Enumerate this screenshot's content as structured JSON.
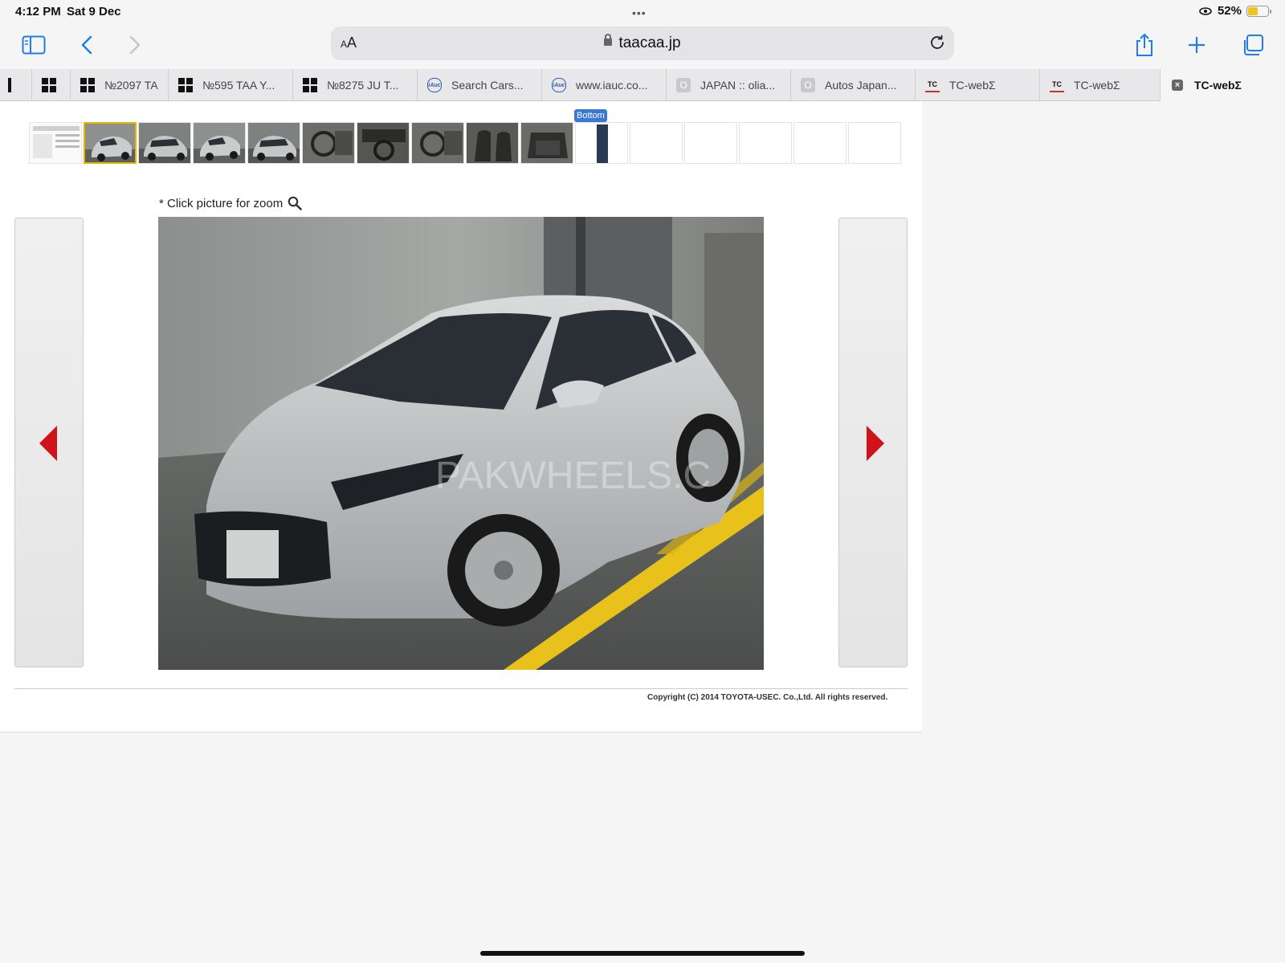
{
  "status_bar": {
    "time": "4:12 PM",
    "date": "Sat 9 Dec",
    "battery": "52%",
    "battery_level": 0.52
  },
  "toolbar": {
    "text_size_label": "AA",
    "url_host": "taacaa.jp",
    "icons": [
      "sidebar-icon",
      "back-icon",
      "forward-icon",
      "reload-icon",
      "share-icon",
      "plus-icon",
      "tabs-icon"
    ]
  },
  "tabs": [
    {
      "label": "",
      "favicon": "windows"
    },
    {
      "label": "№2097 TA",
      "favicon": "windows"
    },
    {
      "label": "№595 TAA Y...",
      "favicon": "windows"
    },
    {
      "label": "№8275 JU T...",
      "favicon": "windows"
    },
    {
      "label": "Search Cars...",
      "favicon": "iauc"
    },
    {
      "label": "www.iauc.co...",
      "favicon": "iauc"
    },
    {
      "label": "JAPAN :: olia...",
      "favicon": "o"
    },
    {
      "label": "Autos Japan...",
      "favicon": "o"
    },
    {
      "label": "TC-webΣ",
      "favicon": "tc"
    },
    {
      "label": "TC-webΣ",
      "favicon": "tc"
    },
    {
      "label": "TC-webΣ",
      "favicon": "close",
      "active": true
    }
  ],
  "page": {
    "bottom_badge": "Bottom",
    "zoom_hint": "* Click picture for zoom",
    "watermark": "PAKWHEELS.C",
    "copyright": "Copyright (C) 2014 TOYOTA-USEC. Co.,Ltd. All rights reserved.",
    "thumbnails": [
      {
        "kind": "document",
        "selected": false
      },
      {
        "kind": "car-front",
        "selected": true
      },
      {
        "kind": "car-rear",
        "selected": false
      },
      {
        "kind": "car-front",
        "selected": false
      },
      {
        "kind": "car-rear",
        "selected": false
      },
      {
        "kind": "interior",
        "selected": false
      },
      {
        "kind": "dashboard",
        "selected": false
      },
      {
        "kind": "interior",
        "selected": false
      },
      {
        "kind": "seats",
        "selected": false
      },
      {
        "kind": "trunk",
        "selected": false
      },
      {
        "kind": "strip",
        "selected": false
      },
      {
        "kind": "empty",
        "selected": false
      },
      {
        "kind": "empty",
        "selected": false
      },
      {
        "kind": "empty",
        "selected": false
      },
      {
        "kind": "empty",
        "selected": false
      },
      {
        "kind": "empty",
        "selected": false
      }
    ],
    "colors": {
      "arrow": "#d0121b",
      "badge": "#3a78d6",
      "selected_thumb_border": "#e7b400",
      "accent": "#1e7cf0"
    }
  }
}
